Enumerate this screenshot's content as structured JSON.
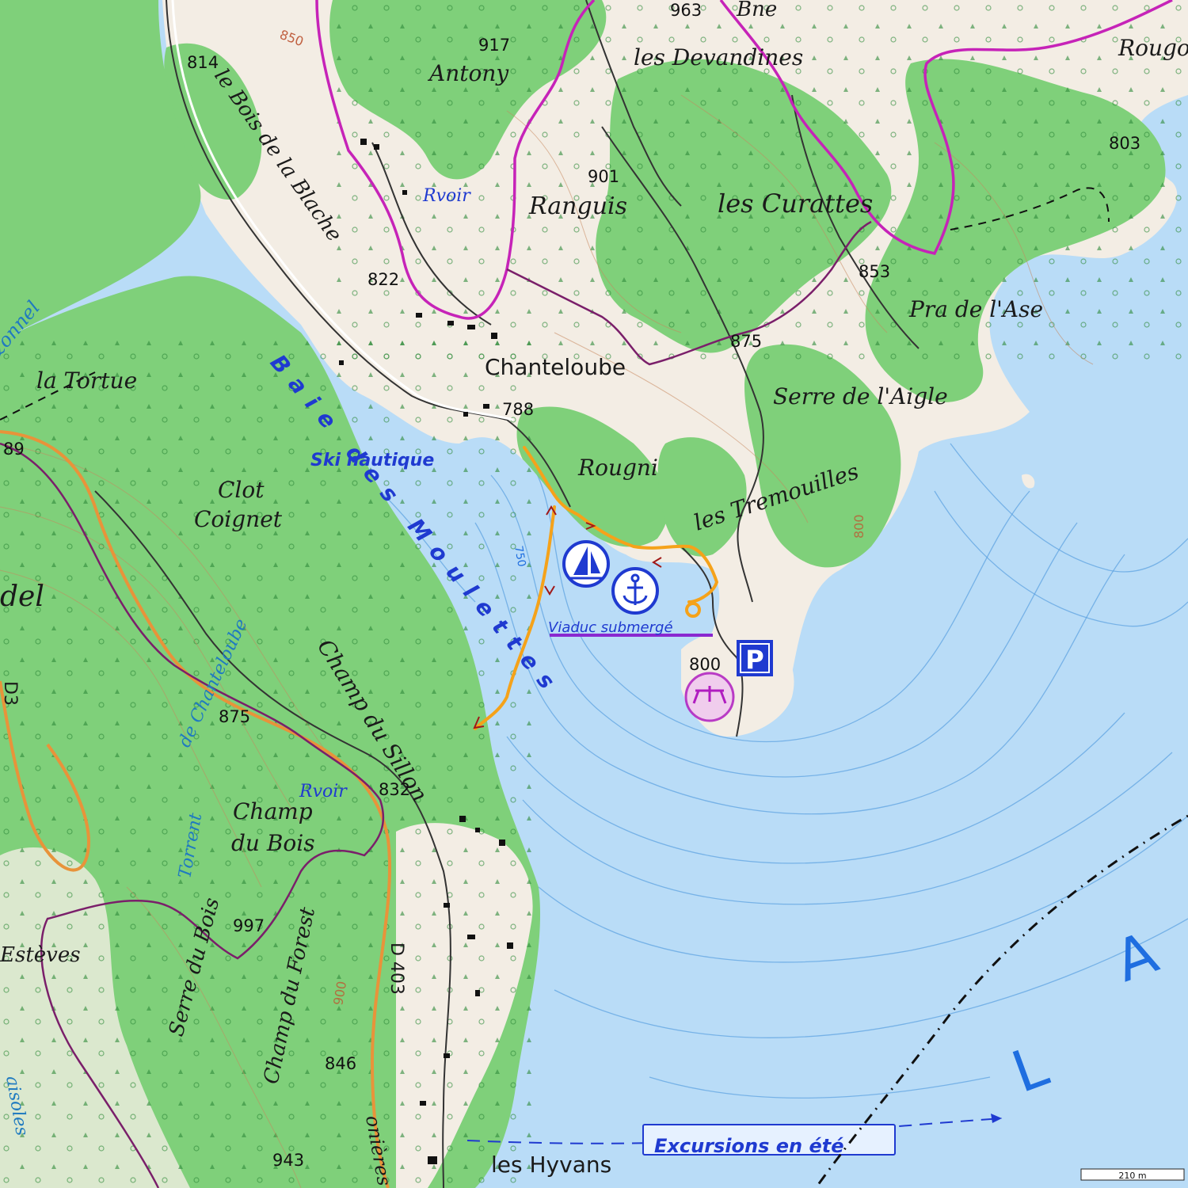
{
  "labels": {
    "bne": "Bne",
    "rougo": "Rougo",
    "devandines": "les Devandines",
    "antony": "Antony",
    "bois_blache": "le Bois de la Blache",
    "rvoir1": "Rvoir",
    "ranguis": "Ranguis",
    "curattes": "les Curattes",
    "pra_ase": "Pra de l'Ase",
    "chanteloube": "Chanteloube",
    "baie": "Baie des Moulettes",
    "ski": "Ski nautique",
    "rougni": "Rougni",
    "serre_aigle": "Serre de l'Aigle",
    "tremouilles": "les Tremouilles",
    "la_tortue": "la Tortue",
    "zonnel": "zonnel",
    "clot": "Clot",
    "coignet": "Coignet",
    "del": "del",
    "champ_sillon": "Champ du Sillon",
    "torrent_chanteloube": "de Chanteloube",
    "rvoir2": "Rvoir",
    "champ_du": "Champ",
    "du_bois": "du Bois",
    "torrent": "Torrent",
    "serre_bois": "Serre du Bois",
    "champ_forest": "Champ du Forest",
    "esteves": "Estèves",
    "d403": "D 403",
    "d3": "D3",
    "hyvans": "les Hyvans",
    "excursions": "Excursions en été",
    "viaduc": "Viaduc submergé",
    "lake_l": "L",
    "lake_a": "A",
    "nieres": "onières",
    "maisoles": "aisoles",
    "parking": "P"
  },
  "altitudes": {
    "a963": "963",
    "a917": "917",
    "a814": "814",
    "a850": "850",
    "a901": "901",
    "a803": "803",
    "a822": "822",
    "a853": "853",
    "a875n": "875",
    "a788": "788",
    "a89": "89",
    "a800": "800",
    "a800b": "800",
    "a750": "750",
    "a875s": "875",
    "a832": "832",
    "a997": "997",
    "a900": "900",
    "a846": "846",
    "a943": "943"
  },
  "scale": {
    "label": "210 m"
  },
  "colors": {
    "water": "#b9dcf7",
    "forest": "#7fd07a",
    "open_land": "#f3ede4",
    "track": "#f5a21a",
    "boundary": "#c623b8",
    "water_text": "#1f3ad0"
  }
}
